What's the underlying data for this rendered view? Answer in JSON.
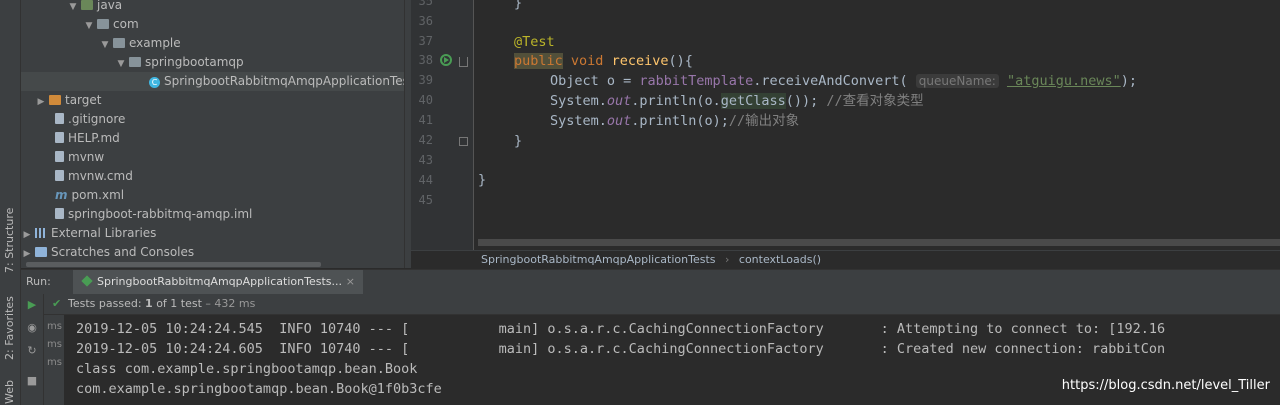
{
  "side_tabs": {
    "structure": "7: Structure",
    "favorites": "2: Favorites",
    "web": "Web"
  },
  "project_tree": [
    {
      "label": "java",
      "icon": "folder-green-icon",
      "expanded": true
    },
    {
      "label": "com",
      "icon": "package-icon",
      "expanded": true
    },
    {
      "label": "example",
      "icon": "package-icon",
      "expanded": true
    },
    {
      "label": "springbootamqp",
      "icon": "package-icon",
      "expanded": true
    },
    {
      "label": "SpringbootRabbitmqAmqpApplicationTests",
      "icon": "java-class-icon"
    },
    {
      "label": "target",
      "icon": "folder-orange-icon",
      "expanded": false
    },
    {
      "label": ".gitignore",
      "icon": "file-icon"
    },
    {
      "label": "HELP.md",
      "icon": "markdown-file-icon"
    },
    {
      "label": "mvnw",
      "icon": "file-icon"
    },
    {
      "label": "mvnw.cmd",
      "icon": "file-icon"
    },
    {
      "label": "pom.xml",
      "icon": "maven-icon"
    },
    {
      "label": "springboot-rabbitmq-amqp.iml",
      "icon": "module-file-icon"
    },
    {
      "label": "External Libraries",
      "icon": "libraries-icon",
      "expanded": false
    },
    {
      "label": "Scratches and Consoles",
      "icon": "scratches-icon",
      "expanded": false
    }
  ],
  "editor": {
    "line_numbers": [
      "35",
      "36",
      "37",
      "38",
      "39",
      "40",
      "41",
      "42",
      "43",
      "44",
      "45"
    ],
    "line35": "}",
    "annotation": "@Test",
    "kw_public": "public",
    "kw_void": "void",
    "method_name": "receive",
    "method_tail": "(){",
    "line39_a": "Object o = ",
    "line39_b": "rabbitTemplate",
    "line39_c": ".receiveAndConvert(",
    "param_hint": "queueName:",
    "string_literal": "\"atguigu.news\"",
    "line39_end": ");",
    "line40_a": "System.",
    "out": "out",
    "line40_b": ".println(o.",
    "getclass": "getClass",
    "line40_c": "()); ",
    "comment40": "//查看对象类型",
    "line41_a": ".println(o);",
    "comment41": "//输出对象",
    "close_brace": "}",
    "class_close": "}"
  },
  "breadcrumb": {
    "class": "SpringbootRabbitmqAmqpApplicationTests",
    "separator": "›",
    "method": "contextLoads()"
  },
  "run": {
    "label": "Run:",
    "tab_title": "SpringbootRabbitmqAmqpApplicationTests...",
    "tab_close": "×",
    "tests_passed": "Tests passed:",
    "count": "1",
    "of_total": "of 1 test",
    "duration": "– 432 ms"
  },
  "console": {
    "ms_labels": [
      "ms",
      "ms",
      "ms"
    ],
    "lines": [
      "2019-12-05 10:24:24.545  INFO 10740 --- [           main] o.s.a.r.c.CachingConnectionFactory       : Attempting to connect to: [192.16",
      "2019-12-05 10:24:24.605  INFO 10740 --- [           main] o.s.a.r.c.CachingConnectionFactory       : Created new connection: rabbitCon",
      "class com.example.springbootamqp.bean.Book",
      "com.example.springbootamqp.bean.Book@1f0b3cfe"
    ]
  },
  "watermark": "https://blog.csdn.net/level_Tiller",
  "colors": {
    "background": "#2b2b2b",
    "panel": "#3c3f41",
    "keyword": "#cc7832",
    "string": "#6a8759",
    "method": "#ffc66d",
    "pass": "#499c54"
  }
}
